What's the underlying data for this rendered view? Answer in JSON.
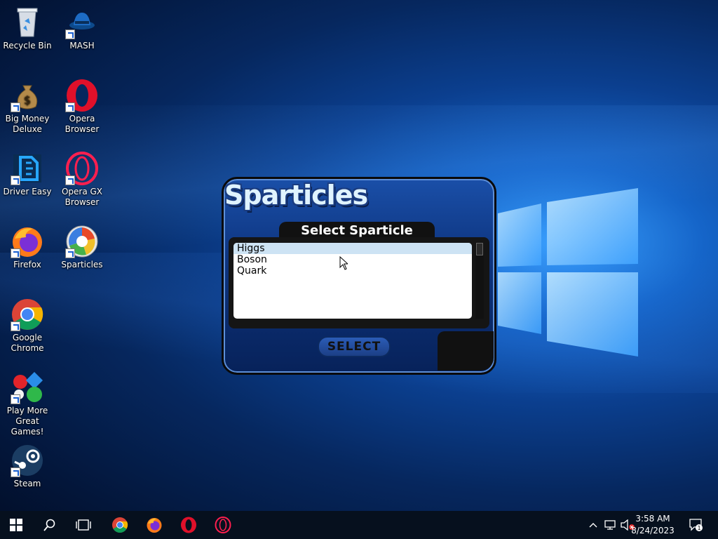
{
  "desktop": {
    "icons": [
      {
        "label": "Recycle Bin",
        "icon": "recycle-bin-icon"
      },
      {
        "label": "MASH",
        "icon": "mash-icon"
      },
      {
        "label": "Big Money Deluxe",
        "icon": "money-bag-icon"
      },
      {
        "label": "Opera Browser",
        "icon": "opera-icon"
      },
      {
        "label": "Driver Easy",
        "icon": "driver-easy-icon"
      },
      {
        "label": "Opera GX Browser",
        "icon": "opera-gx-icon"
      },
      {
        "label": "Firefox",
        "icon": "firefox-icon"
      },
      {
        "label": "Sparticles",
        "icon": "sparticles-icon"
      },
      {
        "label": "Google Chrome",
        "icon": "chrome-icon"
      },
      {
        "label": "Play More Great Games!",
        "icon": "games-icon"
      },
      {
        "label": "Steam",
        "icon": "steam-icon"
      }
    ]
  },
  "game": {
    "logo": "Sparticles",
    "dialog_title": "Select Sparticle",
    "items": [
      "Higgs",
      "Boson",
      "Quark"
    ],
    "selected_index": 0,
    "select_button": "SELECT"
  },
  "taskbar": {
    "pinned": [
      "start-icon",
      "search-icon",
      "task-view-icon",
      "chrome-icon",
      "firefox-icon",
      "opera-icon",
      "opera-gx-icon"
    ],
    "clock_time": "3:58 AM",
    "clock_date": "8/24/2023",
    "notification_count": "1"
  },
  "colors": {
    "taskbar": "#06101e",
    "selection": "#cde3f4",
    "accent": "#1a4fa8"
  }
}
